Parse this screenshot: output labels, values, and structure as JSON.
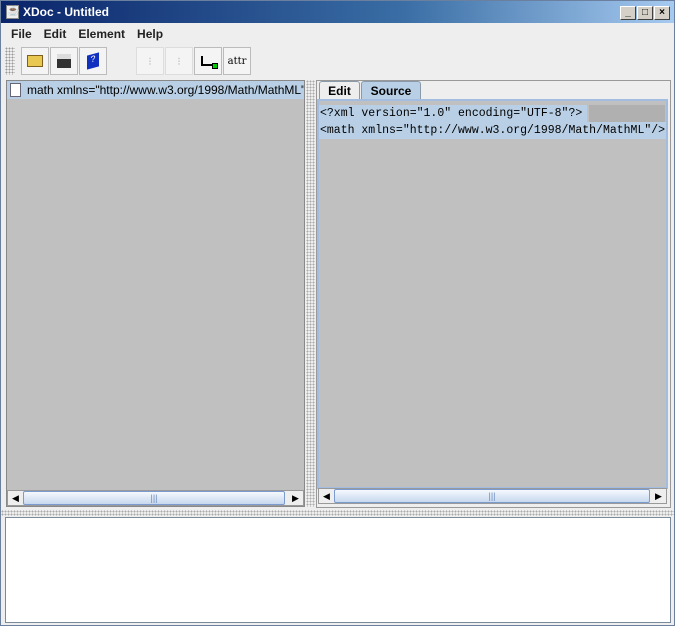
{
  "window": {
    "title": "XDoc - Untitled",
    "controls": [
      "_",
      "□",
      "×"
    ]
  },
  "menu": [
    "File",
    "Edit",
    "Element",
    "Help"
  ],
  "toolbar": {
    "attr_label": "attr"
  },
  "tree": {
    "root_label": "math xmlns=\"http://www.w3.org/1998/Math/MathML\""
  },
  "tabs": [
    "Edit",
    "Source"
  ],
  "source": {
    "lines": [
      "<?xml version=\"1.0\" encoding=\"UTF-8\"?>",
      "<math xmlns=\"http://www.w3.org/1998/Math/MathML\"/>"
    ]
  },
  "scroll": {
    "grip": "|||"
  }
}
